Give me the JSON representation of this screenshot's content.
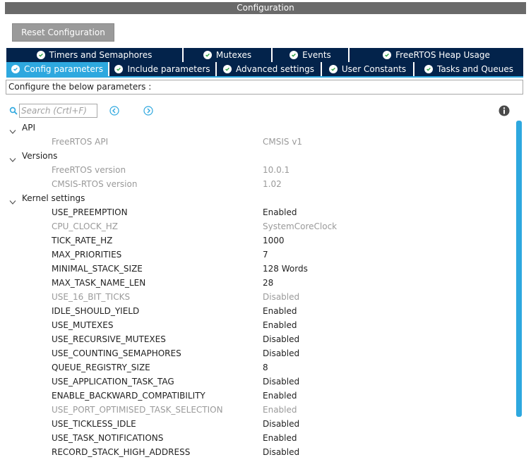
{
  "window": {
    "title": "Configuration"
  },
  "toolbar": {
    "reset_label": "Reset Configuration"
  },
  "tabs": {
    "row1": [
      {
        "label": "Timers and Semaphores",
        "active": false
      },
      {
        "label": "Mutexes",
        "active": false
      },
      {
        "label": "Events",
        "active": false
      },
      {
        "label": "FreeRTOS Heap Usage",
        "active": false
      }
    ],
    "row2": [
      {
        "label": "Config parameters",
        "active": true
      },
      {
        "label": "Include parameters",
        "active": false
      },
      {
        "label": "Advanced settings",
        "active": false
      },
      {
        "label": "User Constants",
        "active": false
      },
      {
        "label": "Tasks and Queues",
        "active": false
      }
    ]
  },
  "description": "Configure the below parameters :",
  "search": {
    "placeholder": "Search (Crtl+F)",
    "value": ""
  },
  "icons": {
    "search": "search-icon",
    "prev": "circle-chevron-left-icon",
    "next": "circle-chevron-right-icon",
    "info": "info-icon",
    "check": "check-circle-icon",
    "caret": "chevron-down-icon"
  },
  "colors": {
    "tab_bg": "#03234b",
    "tab_active": "#2ea8df",
    "title_bar": "#6a6a6a",
    "button": "#9a9a9a",
    "dim_text": "#9a9a9a"
  },
  "groups": [
    {
      "label": "API",
      "params": [
        {
          "name": "FreeRTOS API",
          "value": "CMSIS v1",
          "dim": true
        }
      ]
    },
    {
      "label": "Versions",
      "params": [
        {
          "name": "FreeRTOS version",
          "value": "10.0.1",
          "dim": true
        },
        {
          "name": "CMSIS-RTOS version",
          "value": "1.02",
          "dim": true
        }
      ]
    },
    {
      "label": "Kernel settings",
      "params": [
        {
          "name": "USE_PREEMPTION",
          "value": "Enabled",
          "dim": false
        },
        {
          "name": "CPU_CLOCK_HZ",
          "value": "SystemCoreClock",
          "dim": true
        },
        {
          "name": "TICK_RATE_HZ",
          "value": "1000",
          "dim": false
        },
        {
          "name": "MAX_PRIORITIES",
          "value": "7",
          "dim": false
        },
        {
          "name": "MINIMAL_STACK_SIZE",
          "value": "128 Words",
          "dim": false
        },
        {
          "name": "MAX_TASK_NAME_LEN",
          "value": "28",
          "dim": false
        },
        {
          "name": "USE_16_BIT_TICKS",
          "value": "Disabled",
          "dim": true
        },
        {
          "name": "IDLE_SHOULD_YIELD",
          "value": "Enabled",
          "dim": false
        },
        {
          "name": "USE_MUTEXES",
          "value": "Enabled",
          "dim": false
        },
        {
          "name": "USE_RECURSIVE_MUTEXES",
          "value": "Disabled",
          "dim": false
        },
        {
          "name": "USE_COUNTING_SEMAPHORES",
          "value": "Disabled",
          "dim": false
        },
        {
          "name": "QUEUE_REGISTRY_SIZE",
          "value": "8",
          "dim": false
        },
        {
          "name": "USE_APPLICATION_TASK_TAG",
          "value": "Disabled",
          "dim": false
        },
        {
          "name": "ENABLE_BACKWARD_COMPATIBILITY",
          "value": "Enabled",
          "dim": false
        },
        {
          "name": "USE_PORT_OPTIMISED_TASK_SELECTION",
          "value": "Enabled",
          "dim": true
        },
        {
          "name": "USE_TICKLESS_IDLE",
          "value": "Disabled",
          "dim": false
        },
        {
          "name": "USE_TASK_NOTIFICATIONS",
          "value": "Enabled",
          "dim": false
        },
        {
          "name": "RECORD_STACK_HIGH_ADDRESS",
          "value": "Disabled",
          "dim": false
        }
      ]
    }
  ]
}
